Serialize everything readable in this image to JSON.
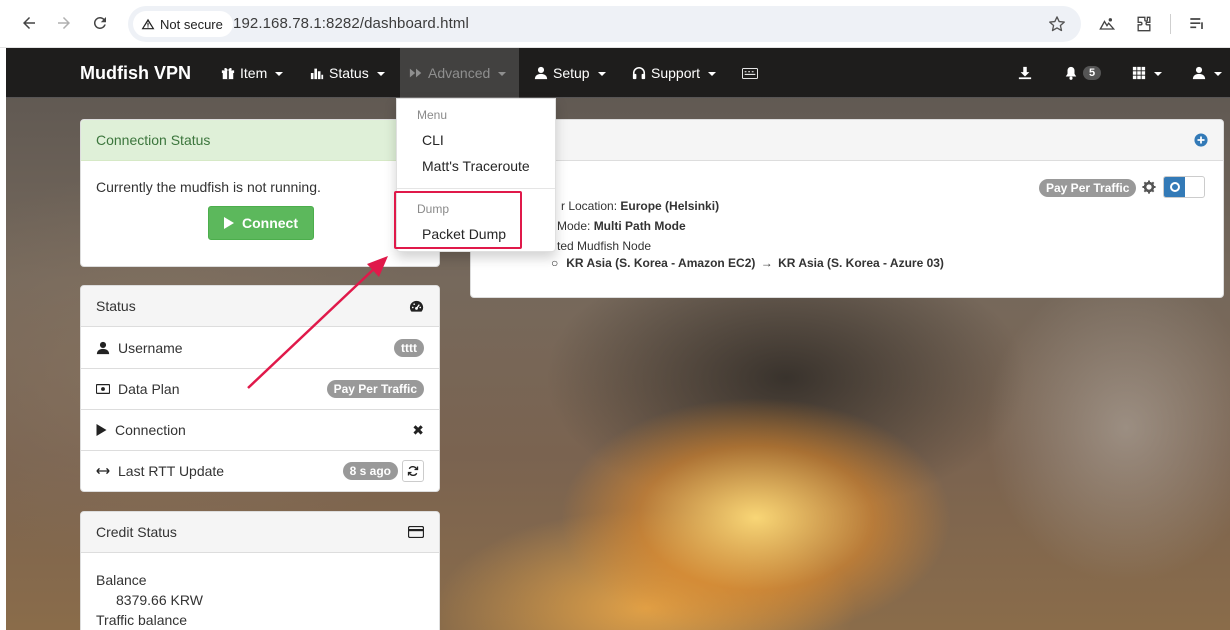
{
  "browser": {
    "security_label": "Not secure",
    "url": "192.168.78.1:8282/dashboard.html"
  },
  "navbar": {
    "brand": "Mudfish VPN",
    "items": [
      {
        "label": "Item",
        "icon": "gift-icon"
      },
      {
        "label": "Status",
        "icon": "bar-chart-icon"
      },
      {
        "label": "Advanced",
        "icon": "forward-icon",
        "active": true
      },
      {
        "label": "Setup",
        "icon": "user-icon"
      },
      {
        "label": "Support",
        "icon": "headphones-icon"
      }
    ],
    "notification_count": "5"
  },
  "dropdown": {
    "menu_header": "Menu",
    "cli": "CLI",
    "traceroute": "Matt's Traceroute",
    "dump_header": "Dump",
    "packet_dump": "Packet Dump"
  },
  "connection_panel": {
    "title": "Connection Status",
    "message": "Currently the mudfish is not running.",
    "connect_label": "Connect"
  },
  "status_panel": {
    "title": "Status",
    "rows": [
      {
        "label": "Username",
        "value": "tttt"
      },
      {
        "label": "Data Plan",
        "value": "Pay Per Traffic"
      },
      {
        "label": "Connection",
        "value": "✖"
      },
      {
        "label": "Last RTT Update",
        "value": "8 s ago"
      }
    ]
  },
  "credit_panel": {
    "title": "Credit Status",
    "balance_label": "Balance",
    "balance_value": "8379.66 KRW",
    "traffic_label": "Traffic balance"
  },
  "route_panel": {
    "plan_badge": "Pay Per Traffic",
    "location_prefix": "r Location: ",
    "location": "Europe (Helsinki)",
    "mode_prefix": "Mode: ",
    "mode": "Multi Path Mode",
    "node_label": "ted Mudfish Node",
    "node_from": "KR Asia (S. Korea - Amazon EC2)",
    "node_arrow": "→",
    "node_to": "KR Asia (S. Korea - Azure 03)"
  },
  "colors": {
    "success": "#5cb85c",
    "primary": "#337ab7",
    "highlight": "#e0194a"
  }
}
